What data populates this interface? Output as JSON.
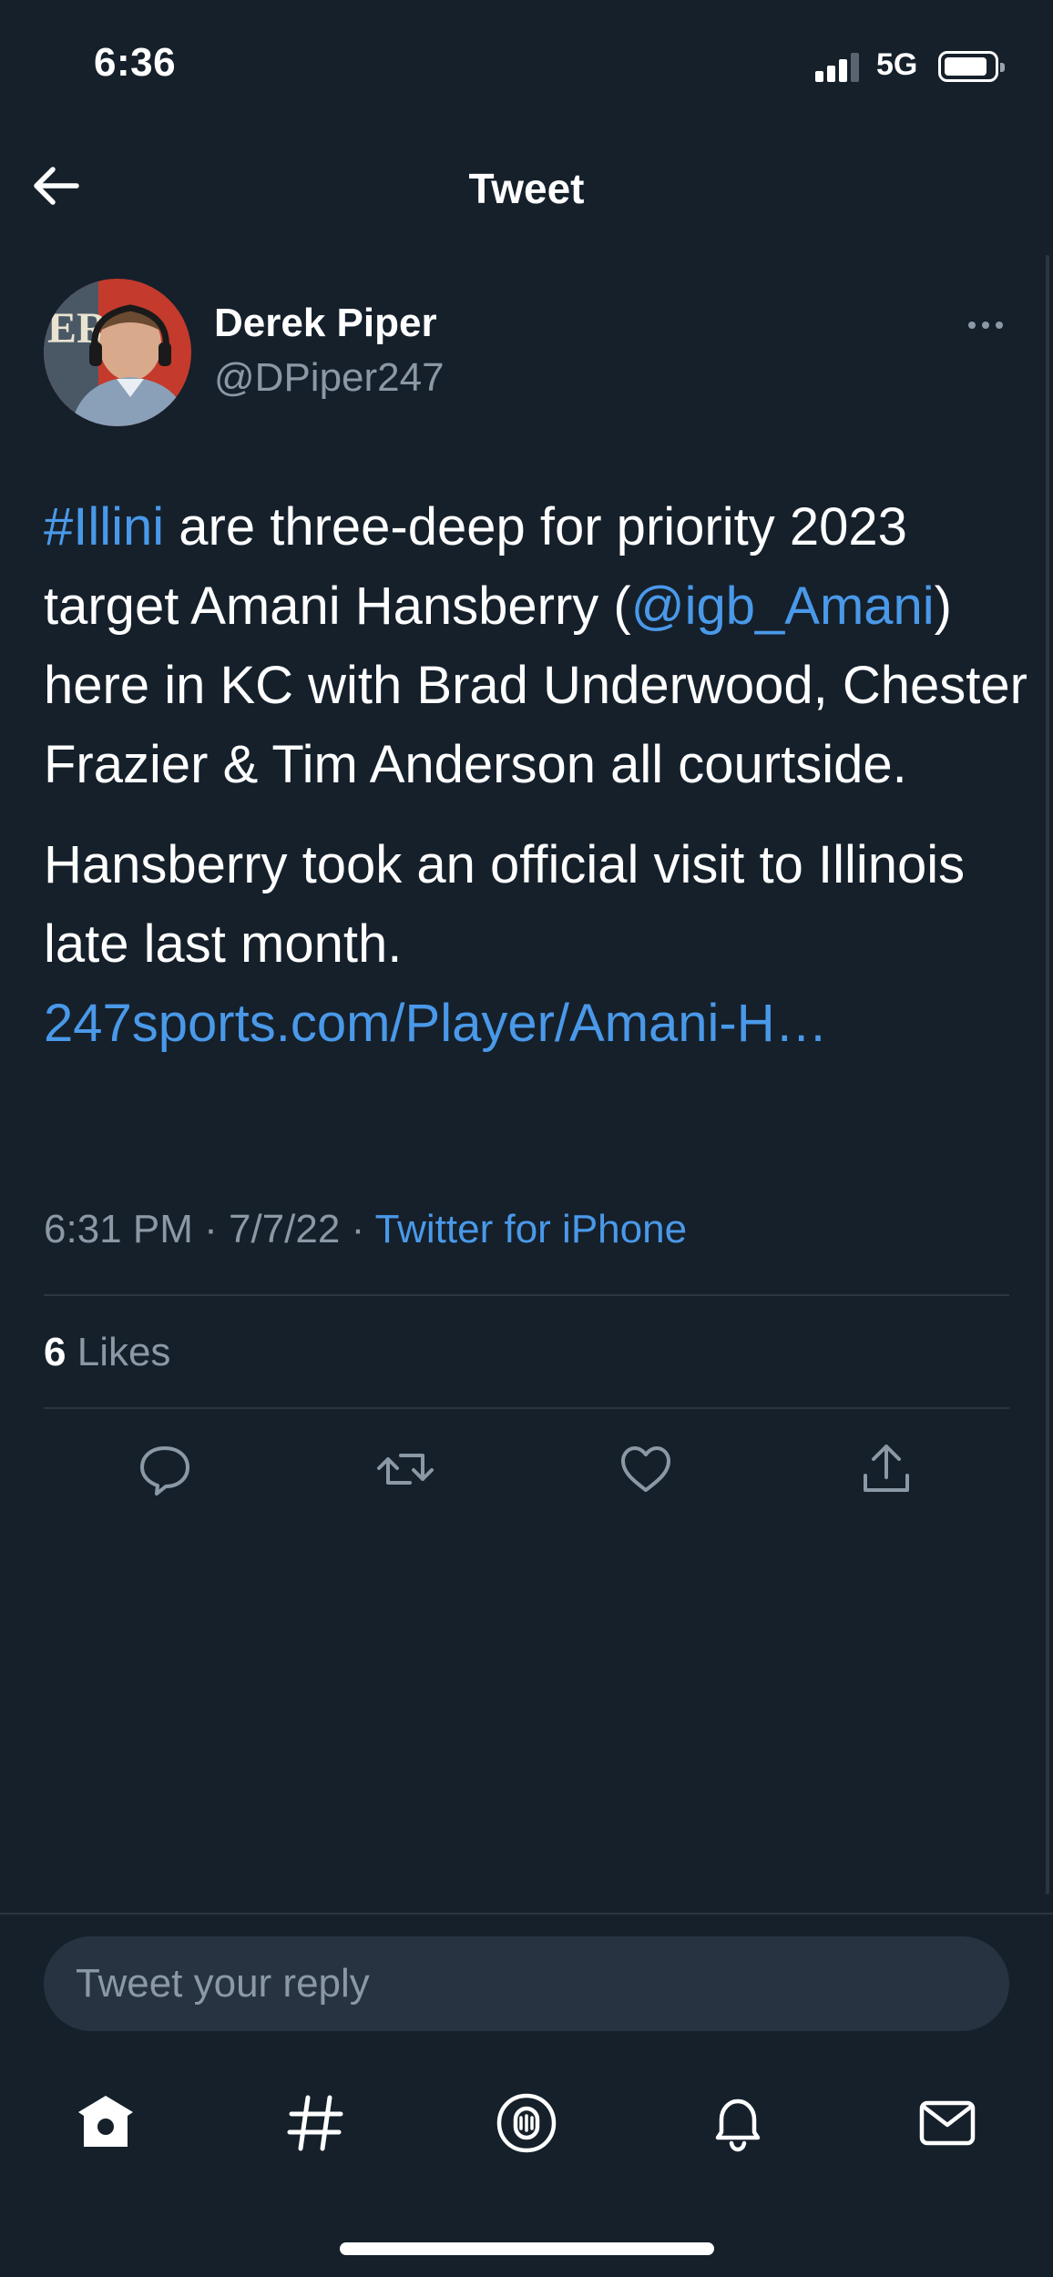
{
  "status_bar": {
    "time": "6:36",
    "network": "5G"
  },
  "header": {
    "title": "Tweet"
  },
  "tweet": {
    "author_name": "Derek Piper",
    "author_handle": "@DPiper247",
    "hashtag": "#Illini",
    "text_part1": " are three-deep for priority 2023 target Amani Hansberry (",
    "mention": "@igb_Amani",
    "text_part2": ") here in KC with Brad Underwood, Chester Frazier & Tim Anderson all courtside.",
    "text_para2": "Hansberry took an official visit to Illinois late last month.",
    "link": "247sports.com/Player/Amani-H…",
    "time": "6:31 PM",
    "date": "7/7/22",
    "separator": "·",
    "source": "Twitter for iPhone",
    "likes_count": "6",
    "likes_label": "Likes"
  },
  "actions": {
    "icons": [
      "reply-icon",
      "retweet-icon",
      "like-icon",
      "share-icon"
    ]
  },
  "reply": {
    "placeholder": "Tweet your reply"
  },
  "tab_bar": {
    "icons": [
      "home-icon",
      "explore-icon",
      "spaces-icon",
      "notifications-icon",
      "messages-icon"
    ]
  },
  "colors": {
    "background": "#15202b",
    "link": "#4a99e9",
    "secondary_text": "#8b98a5"
  }
}
